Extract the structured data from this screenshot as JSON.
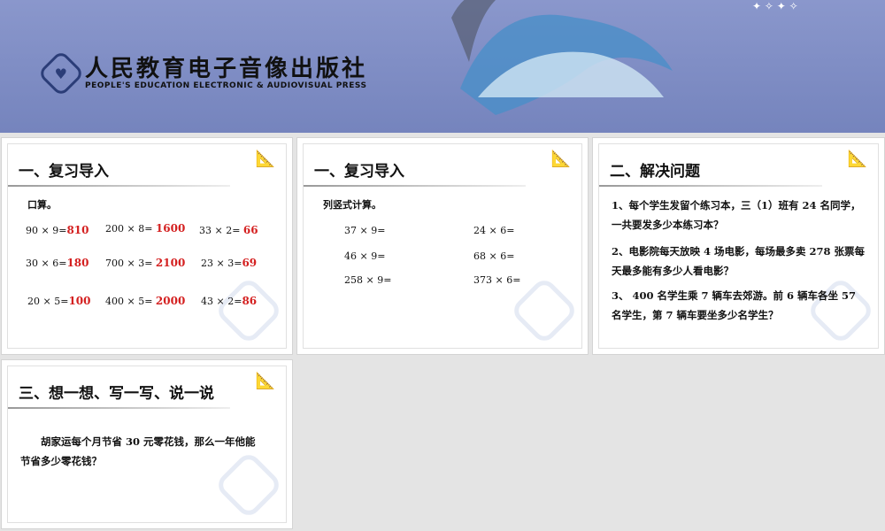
{
  "header": {
    "publisher_cn": "人民教育电子音像出版社",
    "publisher_en": "PEOPLE'S EDUCATION ELECTRONIC & AUDIOVISUAL PRESS"
  },
  "slides": [
    {
      "title": "一、复习导入",
      "subtitle": "口算。",
      "rows": [
        [
          {
            "q": "90 × 9=",
            "a": "810"
          },
          {
            "q": "200 × 8= ",
            "a": "1600"
          },
          {
            "q": "33 × 2= ",
            "a": "66"
          }
        ],
        [
          {
            "q": "30 × 6=",
            "a": "180"
          },
          {
            "q": "700 × 3= ",
            "a": "2100"
          },
          {
            "q": "23 × 3=",
            "a": "69"
          }
        ],
        [
          {
            "q": "20 × 5=",
            "a": "100"
          },
          {
            "q": "400 × 5= ",
            "a": "2000"
          },
          {
            "q": "43 × 2=",
            "a": "86"
          }
        ]
      ]
    },
    {
      "title": "一、复习导入",
      "subtitle": "列竖式计算。",
      "items": [
        "37 × 9=",
        "24 × 6=",
        "46 × 9=",
        "68 × 6=",
        "258 × 9=",
        "373 × 6="
      ]
    },
    {
      "title": "二、解决问题",
      "problems": [
        "1、每个学生发留个练习本，三（1）班有 24 名同学，一共要发多少本练习本？",
        "2、电影院每天放映 4 场电影，每场最多卖 278 张票每天最多能有多少人看电影？",
        "3、 400 名学生乘 7 辆车去郊游。前 6 辆车各坐 57 名学生，第 7 辆车要坐多少名学生？"
      ]
    },
    {
      "title": "三、想一想、写一写、说一说",
      "text": "胡家运每个月节省 30 元零花钱，那么一年他能节省多少零花钱？"
    }
  ]
}
